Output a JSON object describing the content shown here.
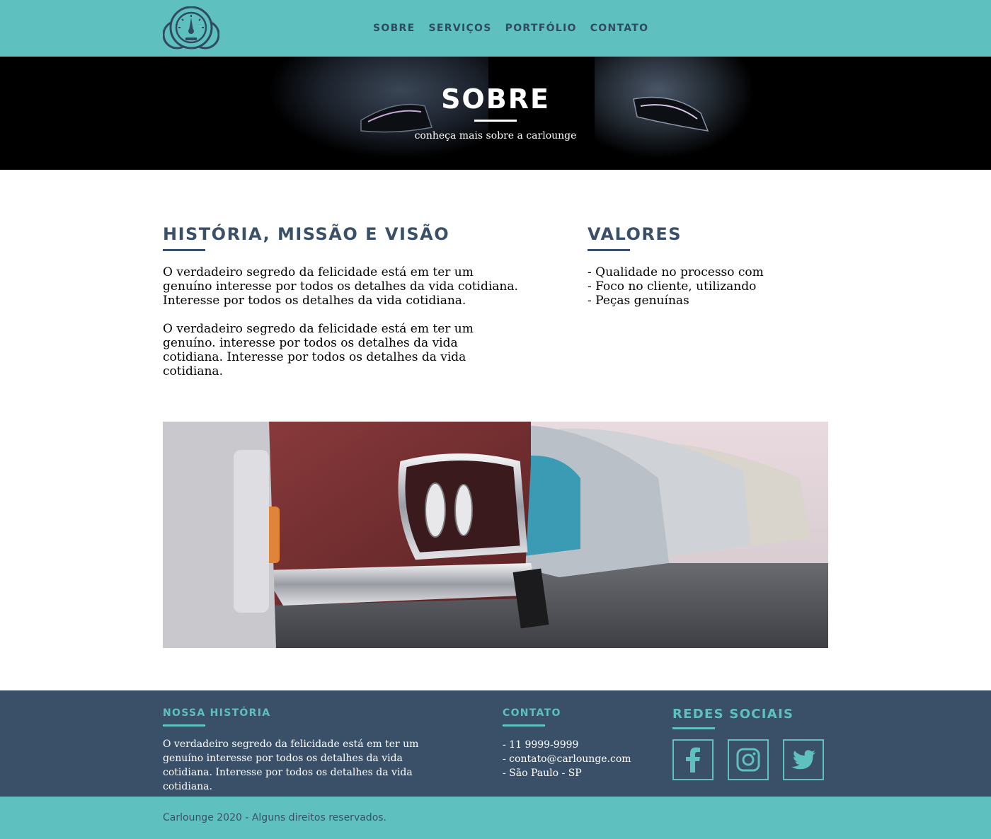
{
  "header": {
    "logo_icon": "speedometer-logo-icon",
    "nav": [
      {
        "label": "SOBRE"
      },
      {
        "label": "SERVIÇOS"
      },
      {
        "label": "PORTFÓLIO"
      },
      {
        "label": "CONTATO"
      }
    ]
  },
  "hero": {
    "title": "SOBRE",
    "subtitle": "conheça mais sobre a carlounge"
  },
  "about": {
    "history": {
      "title": "HISTÓRIA, MISSÃO E VISÃO",
      "paragraphs": [
        "O verdadeiro segredo da felicidade está em ter um genuíno interesse por todos os detalhes da vida cotidiana. Interesse por todos os detalhes da vida cotidiana.",
        "O verdadeiro segredo da felicidade está em ter um genuíno. interesse por todos os detalhes da vida cotidiana. Interesse por todos os detalhes da vida cotidiana."
      ]
    },
    "values": {
      "title": "VALORES",
      "items": [
        "- Qualidade no processo com",
        "- Foco no cliente, utilizando",
        "- Peças genuínas"
      ]
    }
  },
  "footer": {
    "history": {
      "title": "NOSSA HISTÓRIA",
      "text": "O verdadeiro segredo da felicidade está em ter um genuíno interesse por todos os detalhes da vida cotidiana. Interesse por todos os detalhes da vida cotidiana."
    },
    "contact": {
      "title": "CONTATO",
      "items": [
        "- 11 9999-9999",
        "- contato@carlounge.com",
        "- São Paulo - SP"
      ]
    },
    "social": {
      "title": "REDES SOCIAIS",
      "icons": [
        "facebook-icon",
        "instagram-icon",
        "twitter-icon"
      ]
    }
  },
  "copyright": "Carlounge 2020 - Alguns direitos reservados.",
  "colors": {
    "teal": "#5fc0c0",
    "navy": "#3a5069",
    "heading": "#3a4f68"
  }
}
